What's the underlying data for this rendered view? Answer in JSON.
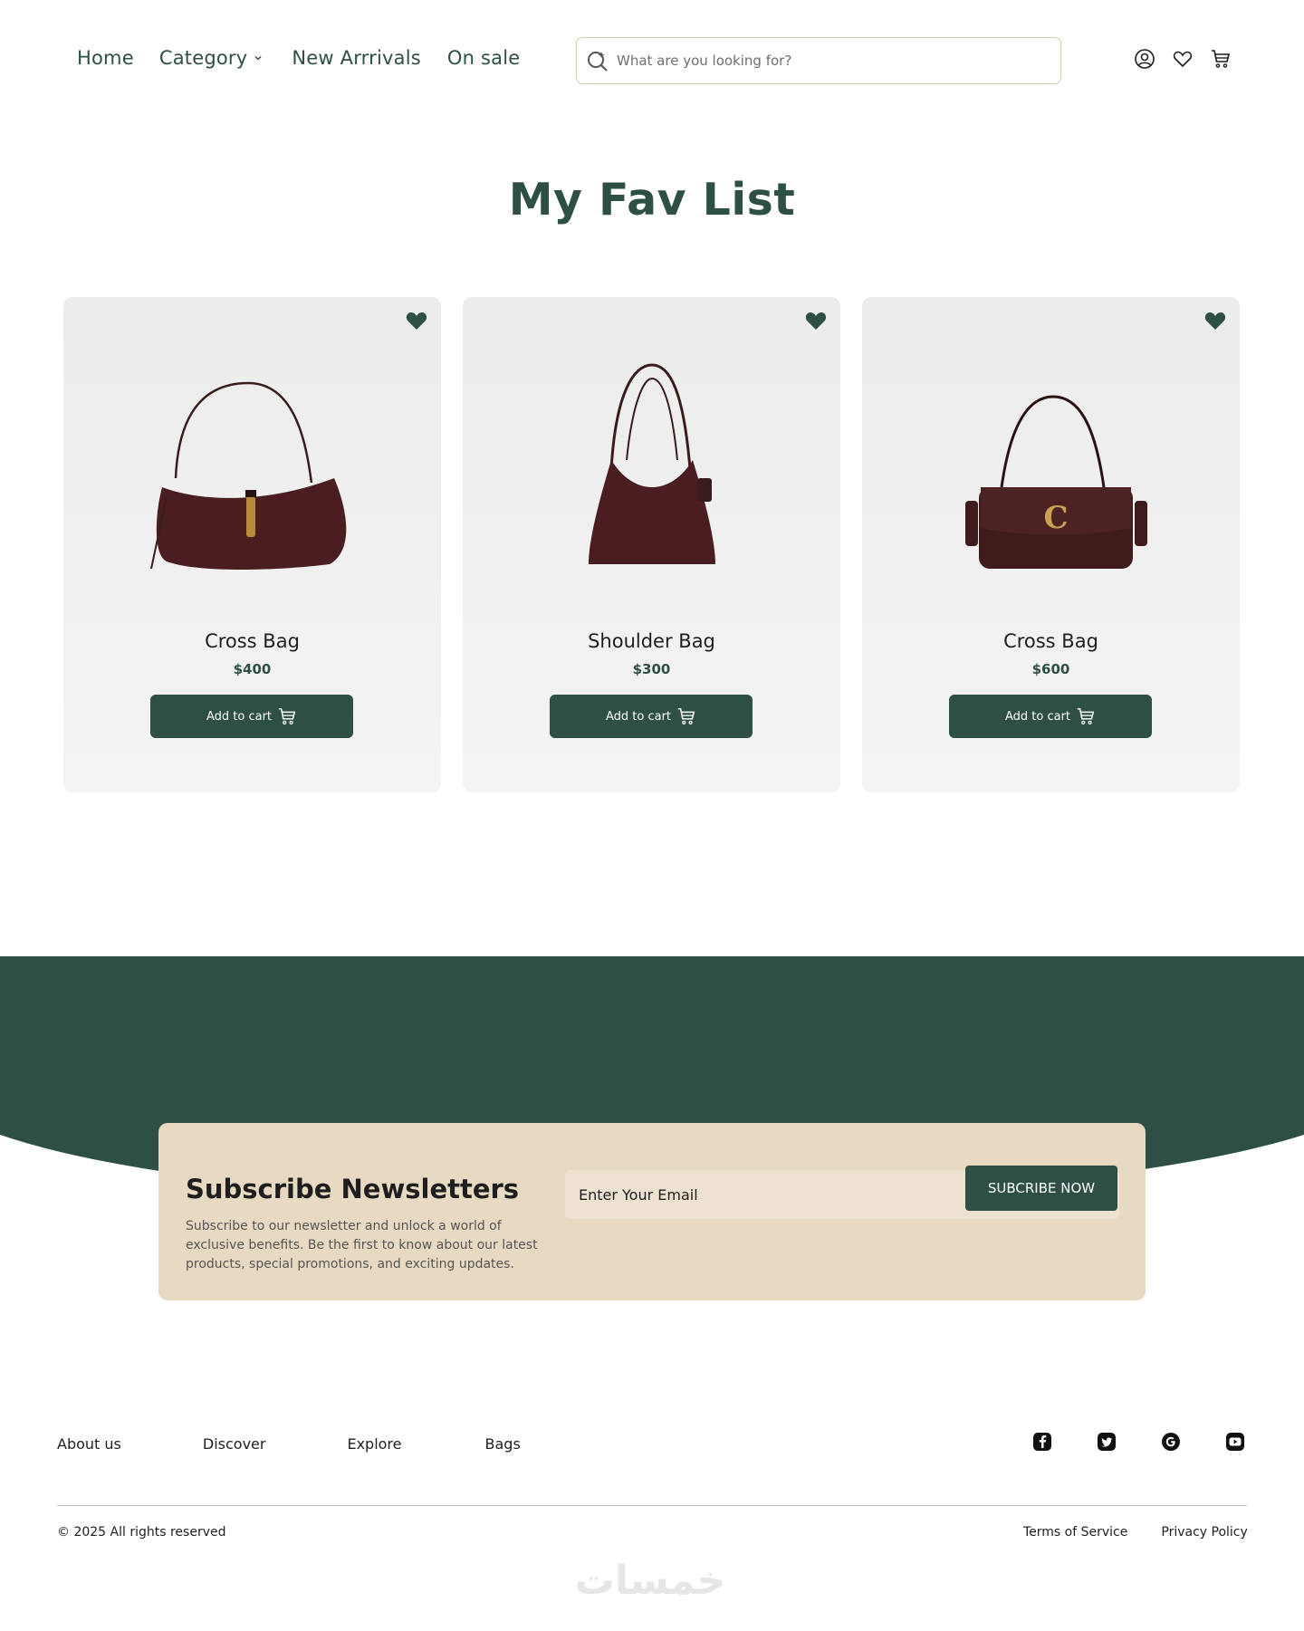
{
  "nav": {
    "home": "Home",
    "category": "Category",
    "new_arrivals": "New Arrrivals",
    "on_sale": "On sale"
  },
  "search": {
    "placeholder": "What are you looking for?"
  },
  "page_title": "My Fav List",
  "products": [
    {
      "name": "Cross Bag",
      "price": "$400",
      "cta": "Add to cart",
      "favorited": true
    },
    {
      "name": "Shoulder Bag",
      "price": "$300",
      "cta": "Add to cart",
      "favorited": true
    },
    {
      "name": "Cross Bag",
      "price": "$600",
      "cta": "Add to cart",
      "favorited": true
    }
  ],
  "newsletter": {
    "title": "Subscribe Newsletters",
    "text": "Subscribe to our newsletter and unlock a world of exclusive benefits. Be the first to know about our latest products, special promotions, and exciting updates.",
    "email_placeholder": "Enter Your Email",
    "button": "SUBCRIBE NOW"
  },
  "footer": {
    "links": [
      "About us",
      "Discover",
      "Explore",
      "Bags"
    ],
    "copyright": "© 2025 All rights reserved",
    "terms": "Terms of Service",
    "privacy": "Privacy Policy",
    "socials": [
      "facebook-icon",
      "twitter-icon",
      "google-icon",
      "youtube-icon"
    ],
    "watermark": "خمسات"
  },
  "colors": {
    "primary": "#2e4f45",
    "beige": "#e8d9c2",
    "card_bg": "#efefef"
  }
}
